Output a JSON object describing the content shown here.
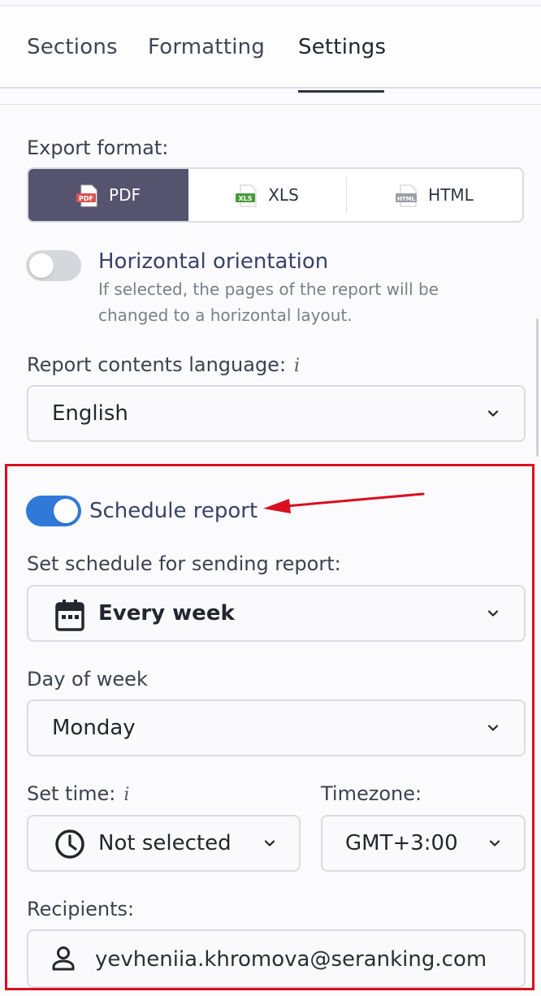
{
  "tabs": [
    {
      "label": "Sections"
    },
    {
      "label": "Formatting"
    },
    {
      "label": "Settings"
    }
  ],
  "export": {
    "label": "Export format:",
    "options": [
      {
        "label": "PDF",
        "badge": "PDF",
        "selected": true
      },
      {
        "label": "XLS",
        "badge": "XLS",
        "selected": false
      },
      {
        "label": "HTML",
        "badge": "HTML",
        "selected": false
      }
    ]
  },
  "orientation": {
    "title": "Horizontal orientation",
    "desc_line1": "If selected, the pages of the report will be",
    "desc_line2": "changed to a horizontal layout.",
    "enabled": false
  },
  "language": {
    "label": "Report contents language:",
    "info": "i",
    "value": "English"
  },
  "schedule": {
    "toggle_label": "Schedule report",
    "enabled": true,
    "frequency_label": "Set schedule for sending report:",
    "frequency_value": "Every week",
    "day_label": "Day of week",
    "day_value": "Monday",
    "time_label": "Set time:",
    "time_info": "i",
    "time_value": "Not selected",
    "timezone_label": "Timezone:",
    "timezone_value": "GMT+3:00",
    "recipients_label": "Recipients:",
    "recipient_email": "yevheniia.khromova@seranking.com"
  },
  "colors": {
    "accent": "#56536f",
    "toggle_on": "#2f7ad9",
    "highlight": "#d8101e",
    "pdf_icon": "#d9534f",
    "xls_icon": "#4a9a3a",
    "html_icon": "#9c9ea6"
  }
}
